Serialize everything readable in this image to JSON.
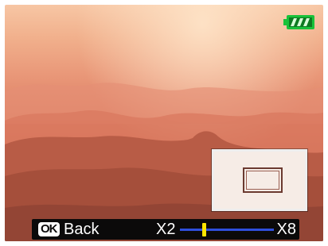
{
  "status": {
    "battery_icon": "battery-full-icon",
    "battery_color": "#19c23a",
    "battery_level": 1.0
  },
  "magnifier": {
    "icon": "zoom-area-indicator"
  },
  "footer": {
    "ok_label": "OK",
    "back_label": "Back",
    "zoom_min_label": "X2",
    "zoom_max_label": "X8",
    "zoom_track_color": "#2f4fdc",
    "zoom_thumb_color": "#ffe600",
    "zoom_level_fraction": 0.25
  }
}
